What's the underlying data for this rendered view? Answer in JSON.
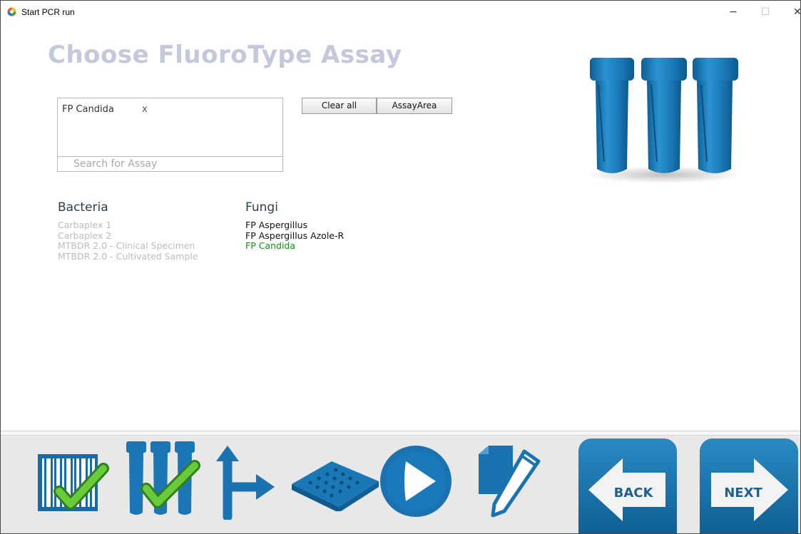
{
  "window": {
    "title": "Start PCR run",
    "controls": {
      "minimize": "−",
      "maximize": "☐",
      "close": "✕"
    }
  },
  "page": {
    "heading": "Choose FluoroType Assay"
  },
  "selection": {
    "chips": [
      {
        "label": "FP Candida",
        "remove": "x"
      }
    ],
    "search_placeholder": "Search for Assay"
  },
  "buttons": {
    "clear_all": "Clear all",
    "assay_area": "AssayArea"
  },
  "categories": {
    "bacteria": {
      "title": "Bacteria",
      "items": [
        "Carbaplex 1",
        "Carbaplex 2",
        "MTBDR 2.0 - Clinical Specimen",
        "MTBDR 2.0 - Cultivated Sample"
      ]
    },
    "fungi": {
      "title": "Fungi",
      "items": [
        "FP Aspergillus",
        "FP Aspergillus Azole-R",
        "FP Candida"
      ],
      "selected": "FP Candida"
    }
  },
  "steps": [
    {
      "name": "barcode-step",
      "status": "done"
    },
    {
      "name": "tubes-step",
      "status": "done"
    },
    {
      "name": "route-step",
      "status": "pending"
    },
    {
      "name": "plate-step",
      "status": "pending"
    },
    {
      "name": "run-step",
      "status": "pending"
    },
    {
      "name": "edit-step",
      "status": "pending"
    }
  ],
  "nav": {
    "back": "BACK",
    "next": "NEXT"
  },
  "colors": {
    "brand_blue": "#1a7bb9",
    "heading": "#c3c8da",
    "selected_green": "#1b8a1b",
    "check_green": "#5cc23a"
  }
}
